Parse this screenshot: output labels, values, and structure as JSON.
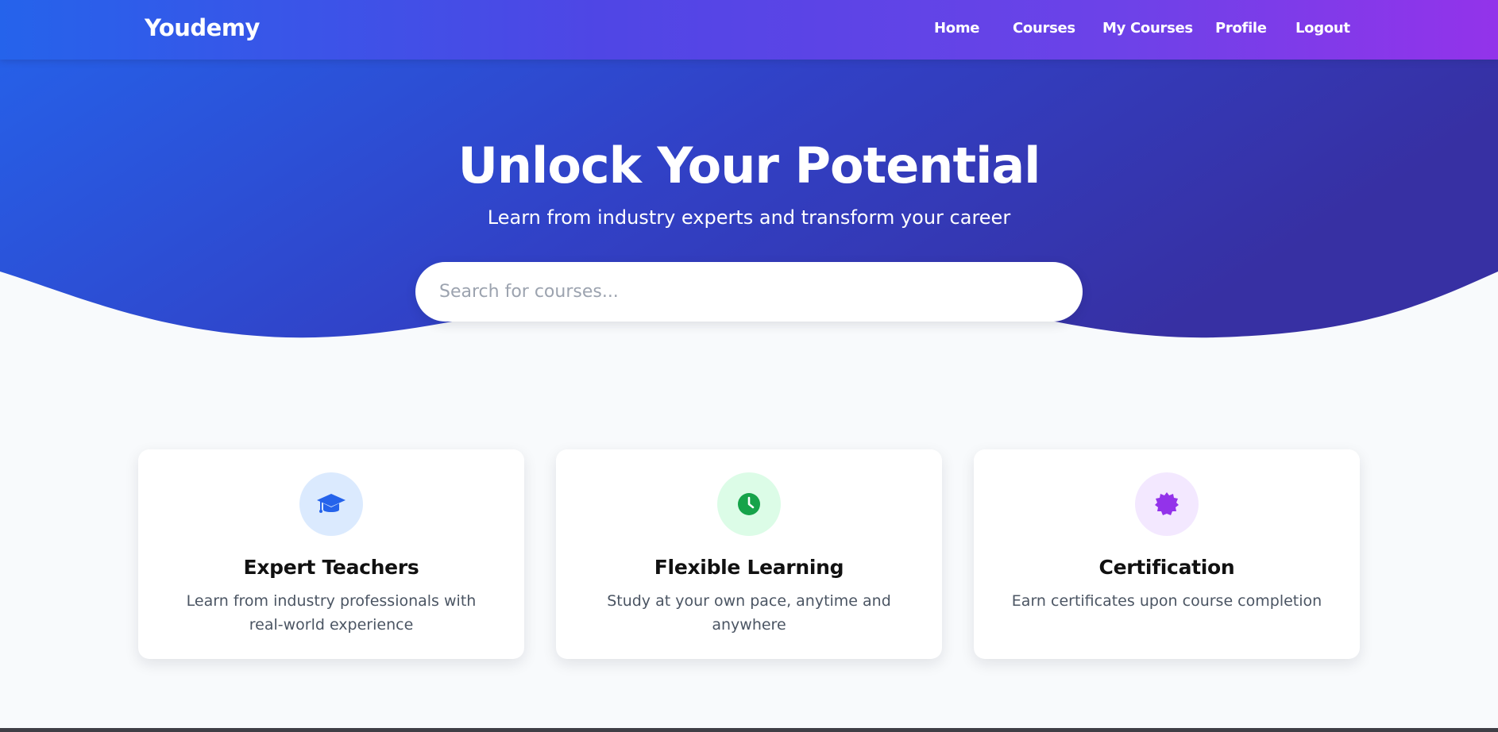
{
  "navbar": {
    "brand": "Youdemy",
    "links": [
      {
        "label": "Home"
      },
      {
        "label": "Courses"
      },
      {
        "label": "My Courses"
      },
      {
        "label": "Profile"
      },
      {
        "label": "Logout"
      }
    ]
  },
  "hero": {
    "title": "Unlock Your Potential",
    "subtitle": "Learn from industry experts and transform your career",
    "search": {
      "placeholder": "Search for courses...",
      "value": ""
    }
  },
  "features": [
    {
      "icon": "graduation-cap-icon",
      "title": "Expert Teachers",
      "description": "Learn from industry professionals with real-world experience",
      "icon_color": "#2563eb",
      "icon_bg": "#dbeafe"
    },
    {
      "icon": "clock-icon",
      "title": "Flexible Learning",
      "description": "Study at your own pace, anytime and anywhere",
      "icon_color": "#16a34a",
      "icon_bg": "#dcfce7"
    },
    {
      "icon": "certificate-icon",
      "title": "Certification",
      "description": "Earn certificates upon course completion",
      "icon_color": "#9333ea",
      "icon_bg": "#f3e8ff"
    }
  ],
  "colors": {
    "hero_gradient_start": "#2563eb",
    "hero_gradient_end": "#3730a3",
    "nav_gradient_end": "#9333ea",
    "page_background": "#f8fafc"
  }
}
